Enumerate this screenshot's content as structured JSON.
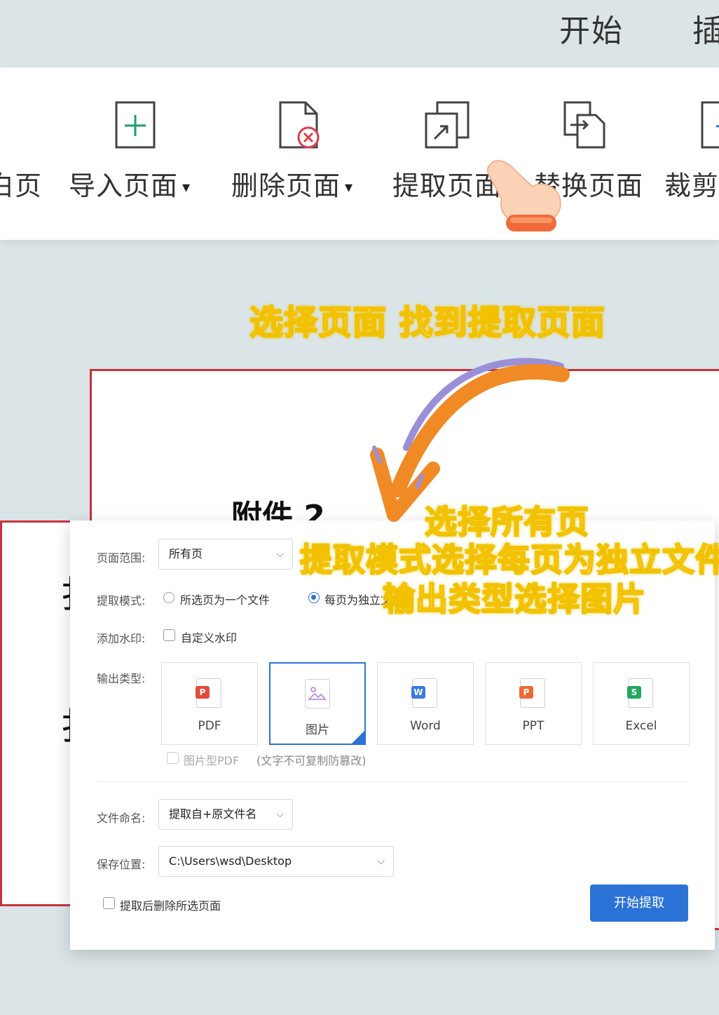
{
  "menu": {
    "tabs": [
      "开始",
      "插"
    ]
  },
  "ribbon": {
    "items": [
      {
        "label": "白页",
        "icon": "blank-page-icon"
      },
      {
        "label": "导入页面",
        "icon": "import-page-icon"
      },
      {
        "label": "删除页面",
        "icon": "delete-page-icon"
      },
      {
        "label": "提取页面",
        "icon": "extract-page-icon"
      },
      {
        "label": "替换页面",
        "icon": "replace-page-icon"
      },
      {
        "label": "裁剪",
        "icon": "crop-icon"
      }
    ]
  },
  "document": {
    "title_fragment": "附件 2",
    "fragment_left_1": "扌",
    "fragment_left_2": "扌"
  },
  "annotations": {
    "top_caption": "选择页面 找到提取页面",
    "caption_line1": "选择所有页",
    "caption_line2": "提取模式选择每页为独立文件",
    "caption_line3": "输出类型选择图片"
  },
  "dialog": {
    "page_range": {
      "label": "页面范围:",
      "value": "所有页"
    },
    "extract_mode": {
      "label": "提取模式:",
      "options": [
        {
          "text": "所选页为一个文件",
          "selected": false
        },
        {
          "text": "每页为独立文件",
          "selected": true
        }
      ]
    },
    "watermark": {
      "label": "添加水印:",
      "option": "自定义水印"
    },
    "output_type": {
      "label": "输出类型:",
      "cards": [
        {
          "name": "PDF",
          "badge": "P",
          "color": "#e5483b",
          "selected": false
        },
        {
          "name": "图片",
          "badge": "",
          "color": "#b07cd6",
          "selected": true
        },
        {
          "name": "Word",
          "badge": "W",
          "color": "#3b7ae3",
          "selected": false
        },
        {
          "name": "PPT",
          "badge": "P",
          "color": "#ee6a35",
          "selected": false
        },
        {
          "name": "Excel",
          "badge": "S",
          "color": "#23a75b",
          "selected": false
        }
      ],
      "image_pdf_option": "图片型PDF",
      "image_pdf_hint": "(文字不可复制防篡改)"
    },
    "file_naming": {
      "label": "文件命名:",
      "value": "提取自+原文件名"
    },
    "save_location": {
      "label": "保存位置:",
      "value": "C:\\Users\\wsd\\Desktop"
    },
    "delete_after": "提取后删除所选页面",
    "start_button": "开始提取"
  }
}
